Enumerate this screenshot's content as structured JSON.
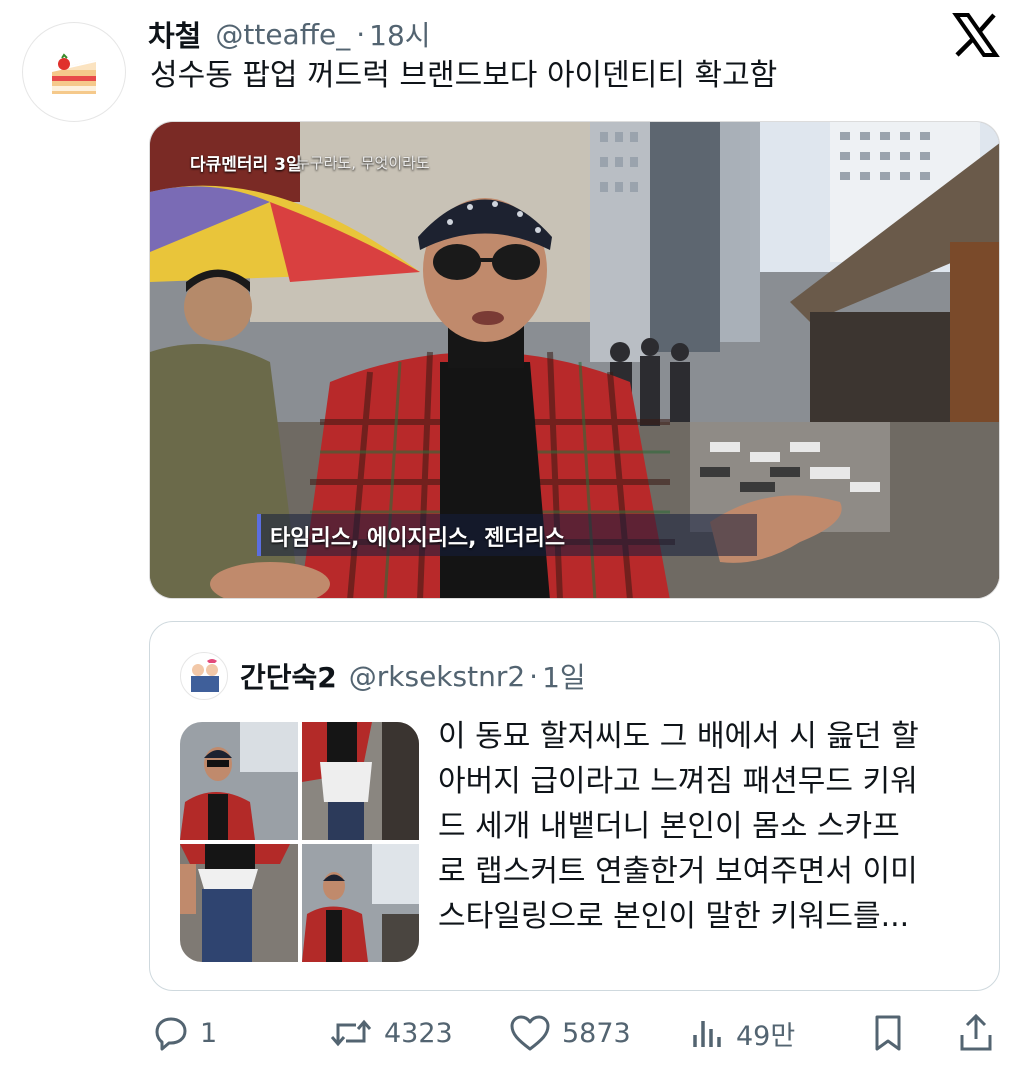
{
  "tweet": {
    "author_name": "차철",
    "handle": "@tteaffe_",
    "separator": "·",
    "time": "18시",
    "text": "성수동 팝업 꺼드럭 브랜드보다 아이덴티티 확고함",
    "media": {
      "overlay_title": "다큐멘터리 3일",
      "overlay_sub": "누구라도, 무엇이라도",
      "caption": "타임리스, 에이지리스, 젠더리스"
    }
  },
  "quoted_tweet": {
    "author_name": "간단숙2",
    "handle": "@rksekstnr2",
    "separator": "·",
    "time": "1일",
    "text_lines": [
      "이 동묘 할저씨도 그 배에서 시 읊던 할",
      "아버지 급이라고 느껴짐 패션무드 키워",
      "드 세개 내뱉더니 본인이 몸소 스카프",
      "로 랩스커트 연출한거 보여주면서 이미",
      "스타일링으로 본인이 말한 키워드를..."
    ]
  },
  "actions": {
    "reply_count": "1",
    "retweet_count": "4323",
    "like_count": "5873",
    "view_count": "49만"
  },
  "colors": {
    "text_primary": "#0f1419",
    "text_secondary": "#536471",
    "border": "#cfd9de"
  },
  "icons": [
    "x-logo-icon",
    "reply-icon",
    "retweet-icon",
    "like-icon",
    "views-icon",
    "bookmark-icon",
    "share-icon"
  ]
}
